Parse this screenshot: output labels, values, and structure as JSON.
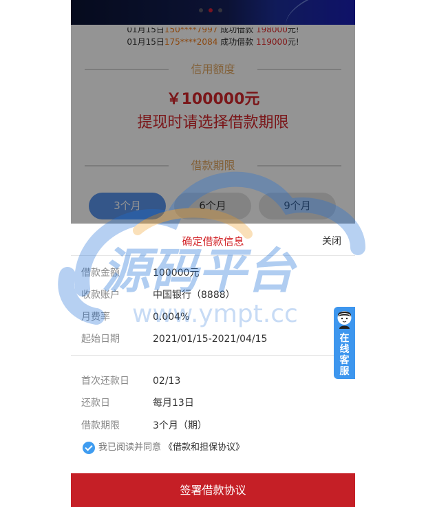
{
  "ticker": {
    "row1": {
      "date": "01月15日",
      "phone": "150****7997",
      "action": "成功借款",
      "amount": "198000",
      "unit": "元!"
    },
    "row2": {
      "date": "01月15日",
      "phone": "175****2084",
      "action": "成功借款",
      "amount": "119000",
      "unit": "元!"
    }
  },
  "credit": {
    "section_title": "信用额度",
    "amount": "￥100000元",
    "hint": "提现时请选择借款期限"
  },
  "loan_term": {
    "section_title": "借款期限",
    "options": [
      "3个月",
      "6个月",
      "9个月"
    ],
    "selected": "3个月"
  },
  "confirm_sheet": {
    "title": "确定借款信息",
    "close_label": "关闭",
    "rows": [
      {
        "label": "借款金额",
        "value": "100000元"
      },
      {
        "label": "收款账户",
        "value": "中国银行（8888）"
      },
      {
        "label": "月费率",
        "value": "0.004%"
      },
      {
        "label": "起始日期",
        "value": "2021/01/15-2021/04/15"
      },
      {
        "label": "首次还款日",
        "value": "02/13"
      },
      {
        "label": "还款日",
        "value": "每月13日"
      },
      {
        "label": "借款期限",
        "value": "3个月（期）"
      }
    ],
    "agree_text": "我已阅读并同意",
    "agreement_link": "《借款和担保协议》",
    "submit_label": "签署借款协议"
  },
  "customer_service": {
    "label": "在线客服",
    "icon": "agent-avatar-icon"
  },
  "watermark": {
    "title": "源码平台",
    "url": "www.ympt.cc"
  },
  "colors": {
    "brand_red": "#c51f26",
    "accent_gold": "#e0a560",
    "selected_blue": "#5b94ec",
    "service_blue": "#3d96ee",
    "ticker_orange": "#f07a18"
  }
}
